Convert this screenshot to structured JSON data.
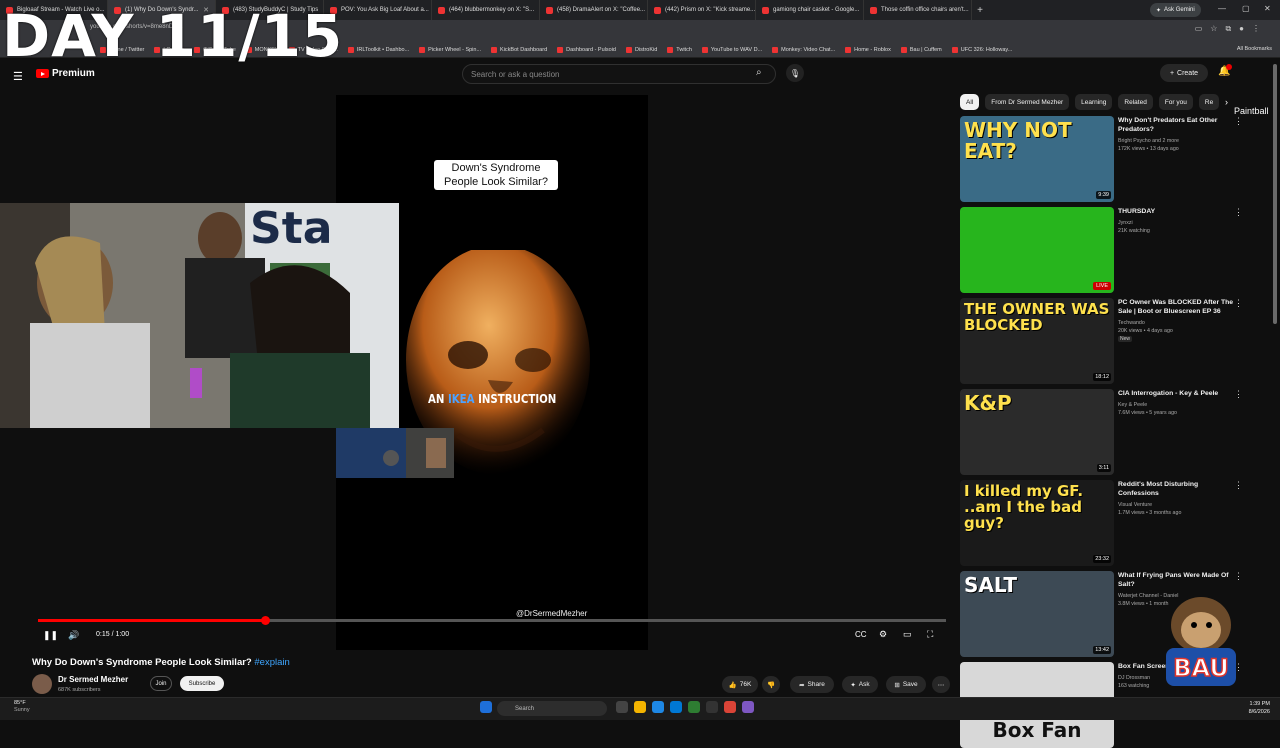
{
  "browser": {
    "tabs": [
      {
        "label": "Bigloaaf Stream - Watch Live o...",
        "active": false
      },
      {
        "label": "(1) Why Do Down's Syndr...",
        "active": true
      },
      {
        "label": "(483) StudyBuddyC | Study Tips",
        "active": false
      },
      {
        "label": "POV: You Ask Big Loaf About a...",
        "active": false
      },
      {
        "label": "(464) blubbermonkey on X: \"S...",
        "active": false
      },
      {
        "label": "(458) DramaAlert on X: \"Coffee...",
        "active": false
      },
      {
        "label": "(442) Prism on X: \"Kick streame...",
        "active": false
      },
      {
        "label": "gamiong chair casket - Google...",
        "active": false
      },
      {
        "label": "Those coffin office chairs aren't...",
        "active": false
      }
    ],
    "new_tab": "+",
    "ask_gemini": "Ask Gemini",
    "url": "youtube.com/shorts/v=8me8nDhl...",
    "bookmarks": [
      "Home / Twitter",
      "| Cuffem",
      "(57) YouTube",
      "MONKEY",
      "TV Video Chat...",
      "IRLToolkit • Dashbo...",
      "Picker Wheel - Spin...",
      "KickBot Dashboard",
      "Dashboard - Pulsoid",
      "DistroKid",
      "Twitch",
      "YouTube to WAV D...",
      "Monkey: Video Chat...",
      "Home - Roblox",
      "Bau | Cuffem",
      "UFC 326: Holloway..."
    ],
    "all_bookmarks": "All Bookmarks"
  },
  "overlay_text": "DAY 11/15",
  "youtube": {
    "logo_text": "Premium",
    "search_placeholder": "Search or ask a question",
    "create_label": "Create",
    "notification_count": "9+"
  },
  "video": {
    "caption": "Down's Syndrome People Look Similar?",
    "subtitle_prefix": "AN ",
    "subtitle_highlight": "IKEA",
    "subtitle_suffix": " INSTRUCTION",
    "handle": "@DrSermedMezher",
    "time": "0:15 / 1:00",
    "progress_fraction": 0.25,
    "title": "Why Do Down's Syndrome People Look Similar?",
    "hashtag": "#explain",
    "channel": "Dr Sermed Mezher",
    "subscribers": "687K subscribers",
    "join": "Join",
    "subscribe": "Subscribe",
    "likes": "76K",
    "share": "Share",
    "ask": "Ask",
    "save": "Save"
  },
  "chips": [
    "All",
    "From Dr Sermed Mezher",
    "Learning",
    "Related",
    "For you",
    "Re"
  ],
  "chip_overflow_text": "Paintball",
  "recommendations": [
    {
      "title": "Why Don't Predators Eat Other Predators?",
      "channel": "Bright Psycho and 2 more",
      "meta": "172K views • 13 days ago",
      "duration": "9:39",
      "thumb_text": "WHY NOT EAT?",
      "thumb_color": "#3a6b86"
    },
    {
      "title": "THURSDAY",
      "channel": "Jynxzi",
      "meta": "21K watching",
      "duration": "LIVE",
      "thumb_text": "",
      "thumb_color": "#27b51d"
    },
    {
      "title": "PC Owner Was BLOCKED After The Sale | Boot or Bluescreen EP 36",
      "channel": "Techwando",
      "meta": "20K views • 4 days ago",
      "badge": "New",
      "duration": "18:12",
      "thumb_text": "THE OWNER WAS BLOCKED",
      "thumb_color": "#222222"
    },
    {
      "title": "CIA Interrogation - Key & Peele",
      "channel": "Key & Peele",
      "meta": "7.6M views • 5 years ago",
      "duration": "3:11",
      "thumb_text": "K&P",
      "thumb_color": "#2b2b2b"
    },
    {
      "title": "Reddit's Most Disturbing Confessions",
      "channel": "Visual Venture",
      "meta": "1.7M views • 3 months ago",
      "duration": "23:32",
      "thumb_text": "I killed my GF. ..am I the bad guy?",
      "thumb_color": "#1a1a1a"
    },
    {
      "title": "What If Frying Pans Were Made Of Salt?",
      "channel": "Waterjet Channel - Daniel",
      "meta": "3.8M views • 1 month",
      "duration": "13:42",
      "thumb_text": "SALT",
      "thumb_color": "#3d4a55"
    },
    {
      "title": "Box Fan Screen",
      "channel": "DJ Drossman",
      "meta": "163 watching",
      "duration": "",
      "thumb_text": "Box Fan",
      "thumb_color": "#d8d8d8"
    }
  ],
  "bau_badge": "BAU",
  "taskbar": {
    "weather_temp": "85°F",
    "weather_desc": "Sunny",
    "search": "Search",
    "time": "1:39 PM",
    "date": "8/6/2026"
  }
}
